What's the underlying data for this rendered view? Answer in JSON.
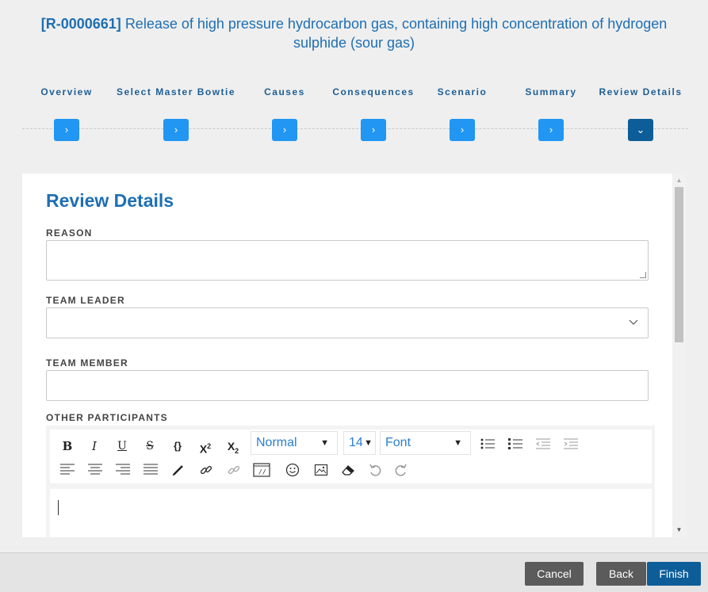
{
  "header": {
    "record_id": "[R-0000661]",
    "title": "Release of high pressure hydrocarbon gas, containing high concentration of hydrogen sulphide (sour gas)"
  },
  "steps": [
    {
      "label": "Overview",
      "icon": "chevron-right-icon",
      "glyph": "›",
      "active": false
    },
    {
      "label": "Select Master Bowtie",
      "icon": "chevron-right-icon",
      "glyph": "›",
      "active": false
    },
    {
      "label": "Causes",
      "icon": "chevron-right-icon",
      "glyph": "›",
      "active": false
    },
    {
      "label": "Consequences",
      "icon": "chevron-right-icon",
      "glyph": "›",
      "active": false
    },
    {
      "label": "Scenario",
      "icon": "chevron-right-icon",
      "glyph": "›",
      "active": false
    },
    {
      "label": "Summary",
      "icon": "chevron-right-icon",
      "glyph": "›",
      "active": false
    },
    {
      "label": "Review Details",
      "icon": "chevron-down-icon",
      "glyph": "⌄",
      "active": true
    }
  ],
  "form": {
    "heading": "Review Details",
    "reason_label": "REASON",
    "reason_value": "",
    "team_leader_label": "TEAM LEADER",
    "team_leader_value": "",
    "team_member_label": "TEAM MEMBER",
    "team_member_value": "",
    "other_participants_label": "OTHER PARTICIPANTS"
  },
  "editor": {
    "buttons": {
      "bold": "B",
      "italic": "I",
      "underline": "U",
      "strike": "S",
      "code": "{}",
      "superscript": "X",
      "subscript": "X",
      "sup_mark": "2",
      "sub_mark": "2"
    },
    "format_select": "Normal",
    "size_select": "14",
    "font_select": "Font"
  },
  "footer": {
    "cancel": "Cancel",
    "back": "Back",
    "finish": "Finish"
  },
  "colors": {
    "accent": "#1e6fb3",
    "step_button": "#2196f3",
    "step_button_active": "#0d5d99",
    "footer_button": "#5b5b5b"
  }
}
